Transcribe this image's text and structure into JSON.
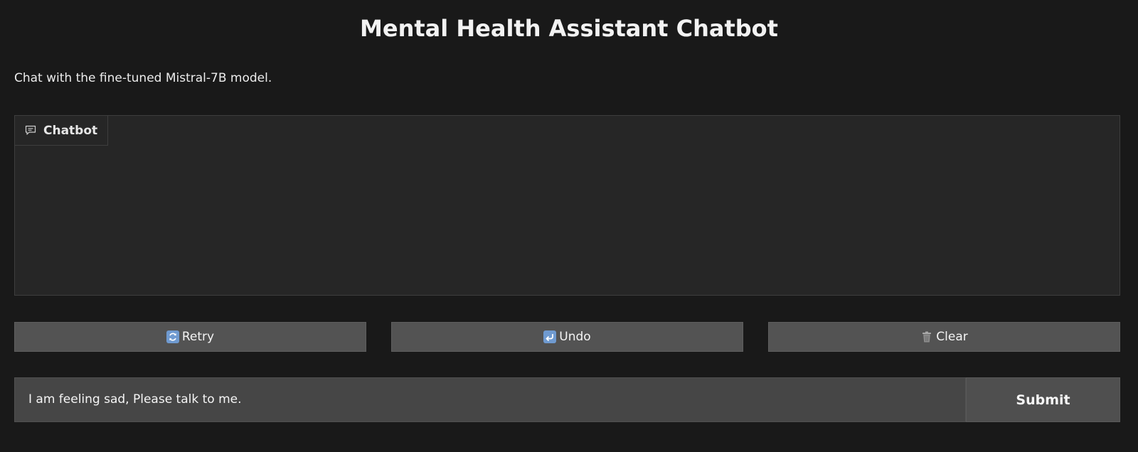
{
  "header": {
    "title": "Mental Health Assistant Chatbot",
    "description": "Chat with the fine-tuned Mistral-7B model."
  },
  "chatbot": {
    "label": "Chatbot",
    "icon": "chat-bubble-icon",
    "messages": []
  },
  "actions": {
    "retry": {
      "label": "Retry",
      "icon": "retry-icon"
    },
    "undo": {
      "label": "Undo",
      "icon": "undo-icon"
    },
    "clear": {
      "label": "Clear",
      "icon": "trash-icon"
    }
  },
  "input": {
    "value": "I am feeling sad, Please talk to me.",
    "submit_label": "Submit"
  },
  "colors": {
    "background": "#191919",
    "panel": "#262626",
    "button": "#535353",
    "input": "#464646",
    "emoji_accent": "#6f9ad0"
  }
}
